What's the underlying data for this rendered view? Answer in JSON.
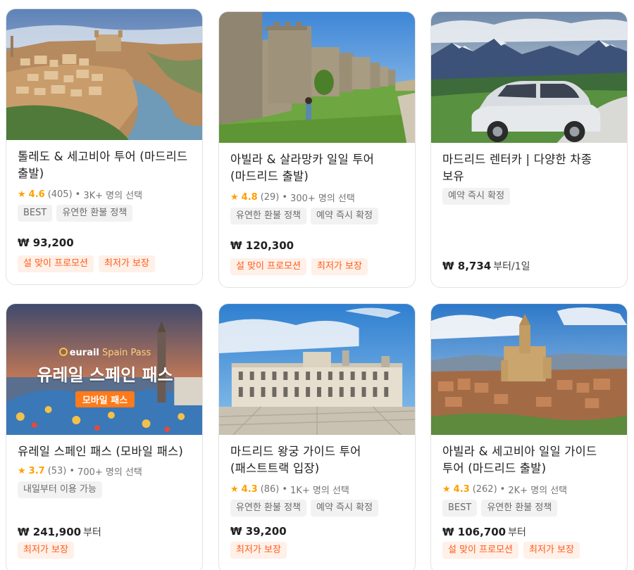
{
  "colors": {
    "accent_star": "#ff9f00",
    "promo_text": "#ff5c1a",
    "promo_bg": "#fff0e8",
    "tag_bg": "#f2f2f2"
  },
  "cards": [
    {
      "title": "톨레도 & 세고비아 투어 (마드리드 출발)",
      "image": "toledo-cityscape",
      "rating": {
        "star": "★",
        "score": "4.6",
        "count": "(405)",
        "dot": "•",
        "chosen": "3K+ 명의 선택"
      },
      "tags": [
        "BEST",
        "유연한 환불 정책"
      ],
      "price": "₩ 93,200",
      "price_suffix": "",
      "promos": [
        "설 맞이 프로모션",
        "최저가 보장"
      ]
    },
    {
      "title": "아빌라 & 살라망카 일일 투어 (마드리드 출발)",
      "image": "avila-city-walls",
      "rating": {
        "star": "★",
        "score": "4.8",
        "count": "(29)",
        "dot": "•",
        "chosen": "300+ 명의 선택"
      },
      "tags": [
        "유연한 환불 정책",
        "예약 즉시 확정"
      ],
      "price": "₩ 120,300",
      "price_suffix": "",
      "promos": [
        "설 맞이 프로모션",
        "최저가 보장"
      ]
    },
    {
      "title": "마드리드 렌터카 | 다양한 차종 보유",
      "image": "rental-car-mountains",
      "rating": null,
      "tags": [
        "예약 즉시 확정"
      ],
      "price": "₩ 8,734",
      "price_suffix": "부터/1일",
      "promos": []
    },
    {
      "title": "유레일 스페인 패스 (모바일 패스)",
      "image": "eurail-spain-pass-banner",
      "banner": {
        "brand": "eurail",
        "brand_sub": "Spain Pass",
        "headline": "유레일 스페인 패스",
        "badge": "모바일 패스"
      },
      "rating": {
        "star": "★",
        "score": "3.7",
        "count": "(53)",
        "dot": "•",
        "chosen": "700+ 명의 선택"
      },
      "tags": [
        "내일부터 이용 가능"
      ],
      "price": "₩ 241,900",
      "price_suffix": "부터",
      "promos": [
        "최저가 보장"
      ]
    },
    {
      "title": "마드리드 왕궁 가이드 투어 (패스트트랙 입장)",
      "image": "royal-palace-madrid",
      "rating": {
        "star": "★",
        "score": "4.3",
        "count": "(86)",
        "dot": "•",
        "chosen": "1K+ 명의 선택"
      },
      "tags": [
        "유연한 환불 정책",
        "예약 즉시 확정"
      ],
      "price": "₩ 39,200",
      "price_suffix": "",
      "promos": [
        "최저가 보장"
      ]
    },
    {
      "title": "아빌라 & 세고비아 일일 가이드 투어 (마드리드 출발)",
      "image": "segovia-cathedral",
      "rating": {
        "star": "★",
        "score": "4.3",
        "count": "(262)",
        "dot": "•",
        "chosen": "2K+ 명의 선택"
      },
      "tags": [
        "BEST",
        "유연한 환불 정책"
      ],
      "price": "₩ 106,700",
      "price_suffix": "부터",
      "promos": [
        "설 맞이 프로모션",
        "최저가 보장"
      ]
    }
  ]
}
